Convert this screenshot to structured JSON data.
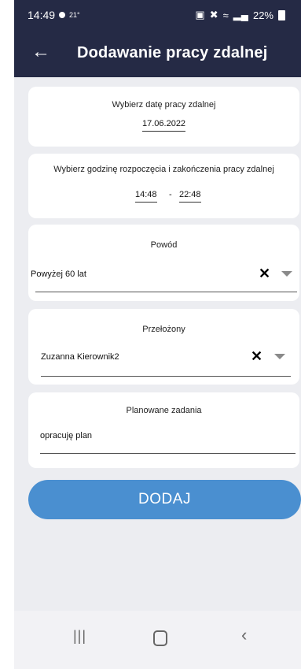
{
  "status_bar": {
    "time": "14:49",
    "temperature": "21°",
    "battery": "22%"
  },
  "header": {
    "back_icon": "arrow-left-icon",
    "title": "Dodawanie pracy zdalnej"
  },
  "date_card": {
    "label": "Wybierz datę pracy zdalnej",
    "date": "17.06.2022"
  },
  "time_card": {
    "label": "Wybierz godzinę rozpoczęcia i zakończenia pracy zdalnej",
    "start": "14:48",
    "separator": "-",
    "end": "22:48"
  },
  "reason_card": {
    "label": "Powód",
    "value": "Powyżej 60 lat"
  },
  "supervisor_card": {
    "label": "Przełożony",
    "value": "Zuzanna Kierownik2"
  },
  "tasks_card": {
    "label": "Planowane zadania",
    "value": "opracuję plan"
  },
  "add_button": {
    "label": "DODAJ"
  },
  "colors": {
    "header_bg": "#252a45",
    "button_bg": "#4a8fd0",
    "page_bg": "#ecedf1"
  },
  "navbar": {
    "recent_icon": "recent-apps-icon",
    "home_icon": "home-icon",
    "back_icon": "back-icon"
  }
}
